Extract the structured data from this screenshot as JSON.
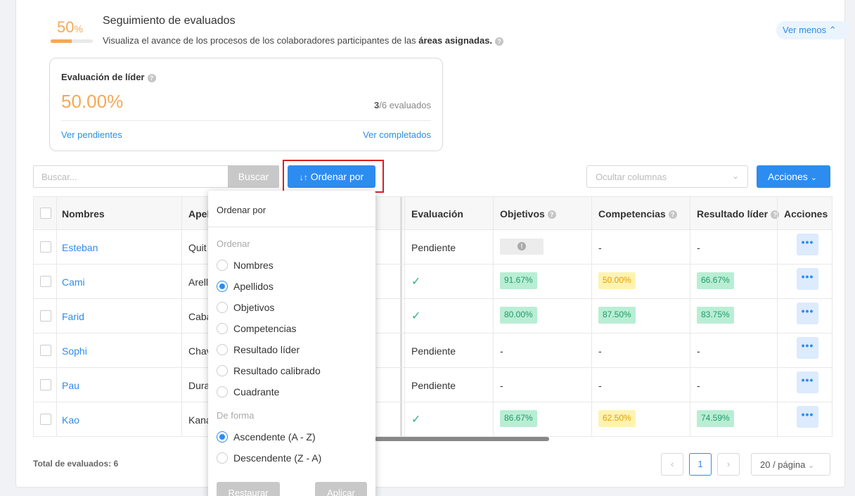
{
  "header": {
    "progress_value": "50",
    "progress_unit": "%",
    "progress_fraction": 0.5,
    "title": "Seguimiento de evaluados",
    "subtitle_pre": "Visualiza el avance de los procesos de los colaboradores participantes de las ",
    "subtitle_bold": "áreas asignadas.",
    "toggle_label": "Ver menos"
  },
  "summary_card": {
    "title": "Evaluación de líder",
    "percentage": "50.00%",
    "count_done": "3",
    "count_rest": "/6 evaluados",
    "link_pending": "Ver pendientes",
    "link_completed": "Ver completados"
  },
  "toolbar": {
    "search_placeholder": "Buscar...",
    "search_button": "Buscar",
    "sort_button": "Ordenar por",
    "columns_placeholder": "Ocultar columnas",
    "actions_button": "Acciones"
  },
  "table": {
    "headers": {
      "names": "Nombres",
      "surnames": "Apel",
      "evaluation": "Evaluación",
      "objectives": "Objetivos",
      "competencies": "Competencias",
      "leader_result": "Resultado líder",
      "actions": "Acciones"
    },
    "rows": [
      {
        "name": "Esteban",
        "surname": "Quit",
        "evaluation": "Pendiente",
        "objectives": "",
        "competencies": "-",
        "leader": "-"
      },
      {
        "name": "Cami",
        "surname": "Arell",
        "evaluation": "",
        "objectives": "91.67%",
        "competencies": "50.00%",
        "leader": "66.67%"
      },
      {
        "name": "Farid",
        "surname": "Caba",
        "evaluation": "",
        "objectives": "80.00%",
        "competencies": "87.50%",
        "leader": "83.75%"
      },
      {
        "name": "Sophi",
        "surname": "Chav",
        "evaluation": "Pendiente",
        "objectives": "-",
        "competencies": "-",
        "leader": "-"
      },
      {
        "name": "Pau",
        "surname": "Dura",
        "evaluation": "Pendiente",
        "objectives": "-",
        "competencies": "-",
        "leader": "-"
      },
      {
        "name": "Kao",
        "surname": "Kana",
        "evaluation": "",
        "objectives": "86.67%",
        "competencies": "62.50%",
        "leader": "74.59%"
      }
    ]
  },
  "footer": {
    "total_label": "Total de evaluados: 6",
    "current_page": "1",
    "page_size": "20 / página"
  },
  "sort_dropdown": {
    "title": "Ordenar por",
    "section_order": "Ordenar",
    "options": [
      "Nombres",
      "Apellidos",
      "Objetivos",
      "Competencias",
      "Resultado líder",
      "Resultado calibrado",
      "Cuadrante"
    ],
    "selected_option": "Apellidos",
    "section_direction": "De forma",
    "directions": [
      "Ascendente (A - Z)",
      "Descendente (Z - A)"
    ],
    "selected_direction": "Ascendente (A - Z)",
    "reset_button": "Restaurar",
    "apply_button": "Aplicar"
  },
  "colors": {
    "accent": "#2d8cf0",
    "orange": "#f5a957",
    "green_badge": "#b9eed4",
    "yellow_badge": "#fff3b0",
    "highlight_border": "#d92020"
  }
}
